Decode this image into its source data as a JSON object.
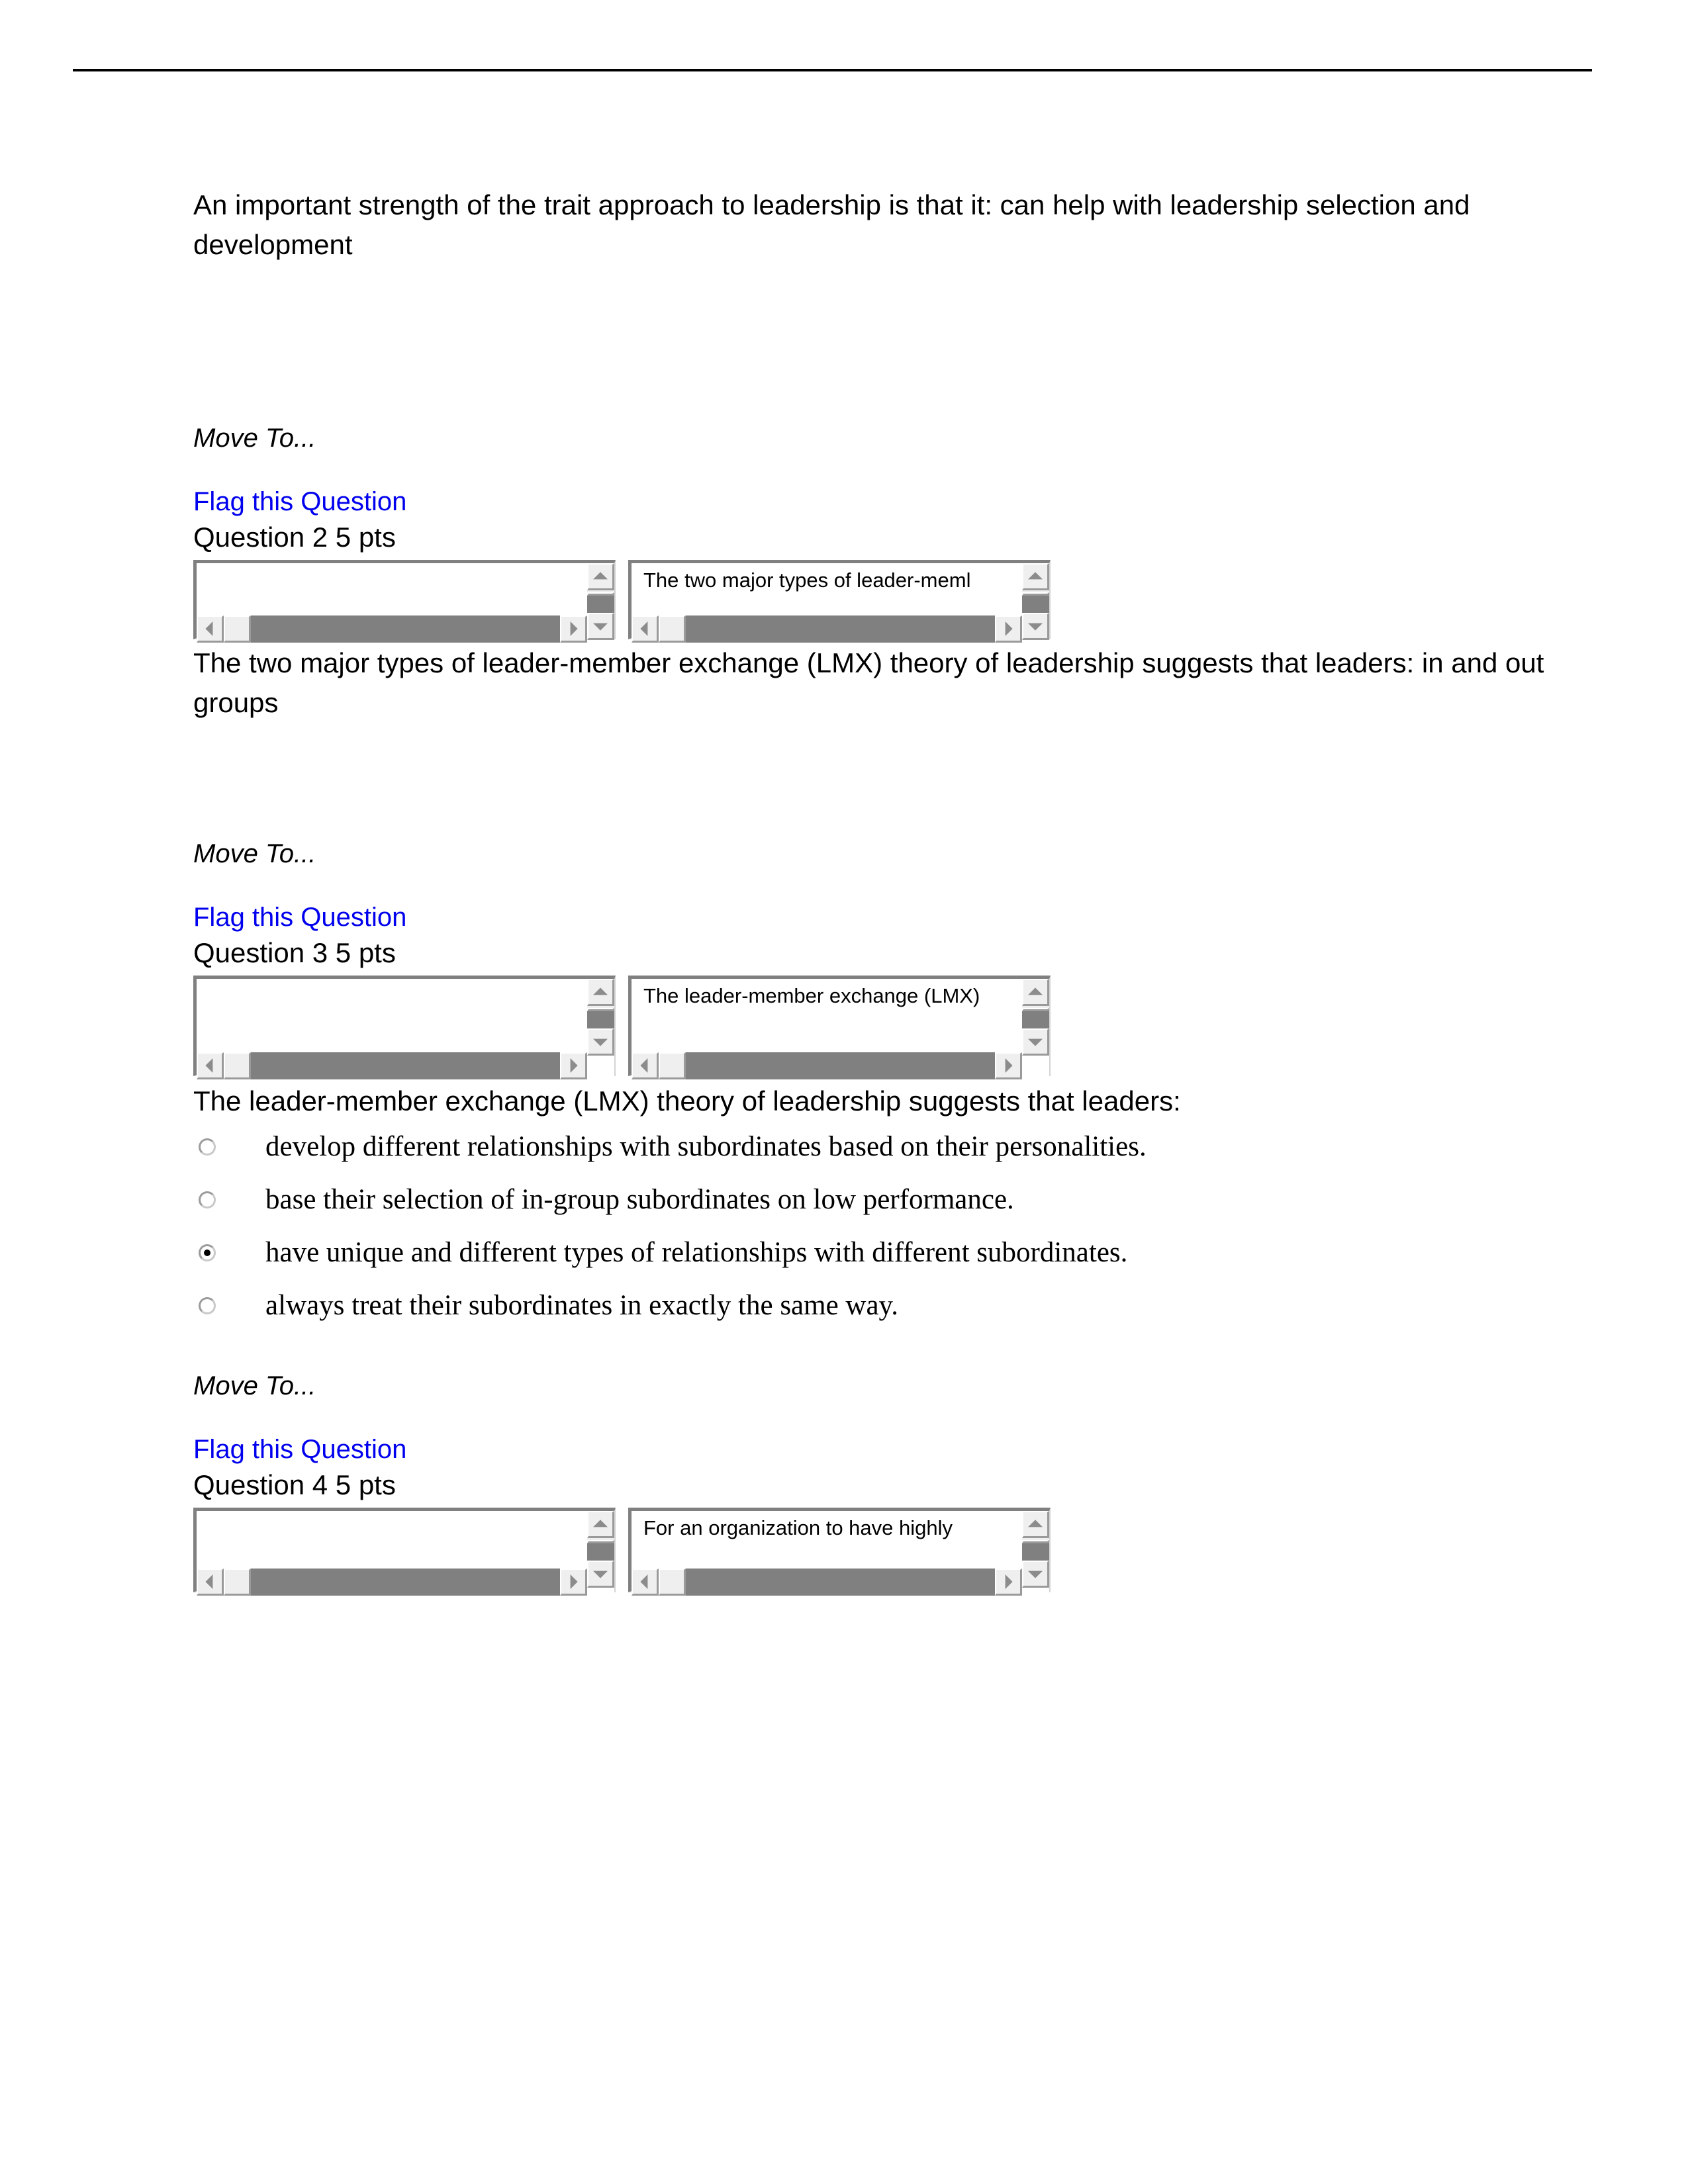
{
  "document": {
    "has_top_rule": true,
    "link_color": "#0000ee"
  },
  "intro": {
    "answered_statement": "An important strength of the trait approach to leadership is that it: can help with leadership selection and development"
  },
  "labels": {
    "move_to": "Move To...",
    "flag_question": "Flag this Question"
  },
  "scroll_widget": {
    "left_pane_text": "",
    "vertical_scrollbar": {
      "up_arrow": "scroll-up-arrow",
      "down_arrow": "scroll-down-arrow",
      "thumb_position": "bottom"
    },
    "horizontal_scrollbar": {
      "left_arrow": "scroll-left-arrow",
      "right_arrow": "scroll-right-arrow",
      "thumb_position": "middle"
    }
  },
  "questions": [
    {
      "header": "Question 2 5 pts",
      "preview_text": "The two major types of leader-meml",
      "statement": "The two major types of leader-member exchange (LMX) theory of leadership suggests that leaders: in and out groups",
      "options": []
    },
    {
      "header": "Question 3 5 pts",
      "preview_text": "The leader-member exchange (LMX)",
      "statement": "The leader-member exchange (LMX) theory of leadership suggests that leaders:",
      "options": [
        {
          "label": "develop different relationships with subordinates based on their personalities.",
          "selected": false
        },
        {
          "label": "base their selection of in-group subordinates on low performance.",
          "selected": false
        },
        {
          "label": "have unique and different types of relationships with different subordinates.",
          "selected": true
        },
        {
          "label": "always treat their subordinates in exactly the same way.",
          "selected": false
        }
      ]
    },
    {
      "header": "Question 4 5 pts",
      "preview_text": "For an organization to have highly ",
      "statement": "",
      "options": []
    }
  ]
}
